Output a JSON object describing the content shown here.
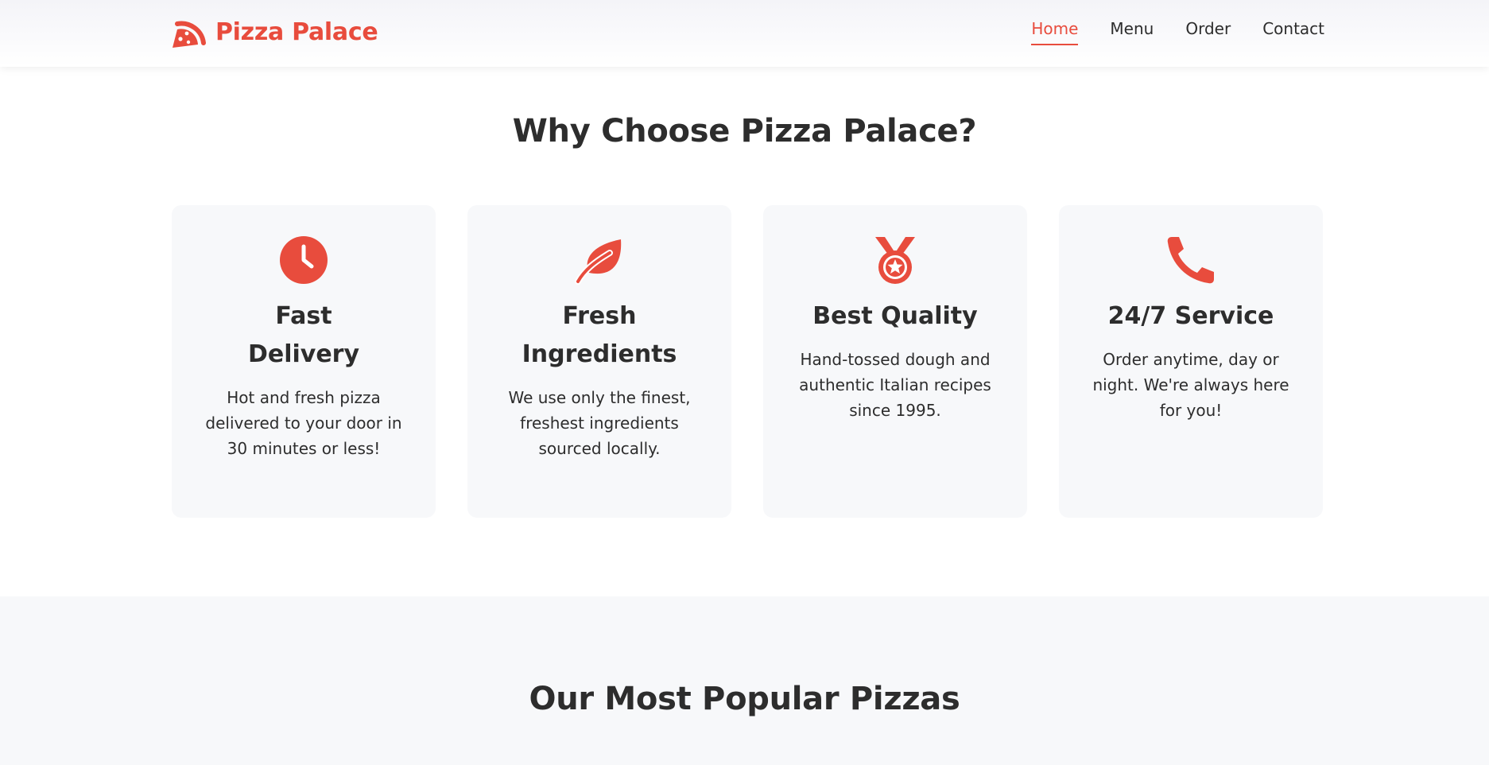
{
  "header": {
    "brand": "Pizza Palace",
    "logo_icon": "pizza-slice-icon",
    "accent_color": "#e84c3d",
    "nav": [
      {
        "label": "Home",
        "active": true
      },
      {
        "label": "Menu",
        "active": false
      },
      {
        "label": "Order",
        "active": false
      },
      {
        "label": "Contact",
        "active": false
      }
    ]
  },
  "features": {
    "title": "Why Choose Pizza Palace?",
    "cards": [
      {
        "icon": "clock-icon",
        "title": "Fast Delivery",
        "text": "Hot and fresh pizza delivered to your door in 30 minutes or less!"
      },
      {
        "icon": "leaf-icon",
        "title": "Fresh Ingredients",
        "text": "We use only the finest, freshest ingredients sourced locally."
      },
      {
        "icon": "medal-icon",
        "title": "Best Quality",
        "text": "Hand-tossed dough and authentic Italian recipes since 1995."
      },
      {
        "icon": "phone-icon",
        "title": "24/7 Service",
        "text": "Order anytime, day or night. We're always here for you!"
      }
    ]
  },
  "popular": {
    "title": "Our Most Popular Pizzas"
  }
}
